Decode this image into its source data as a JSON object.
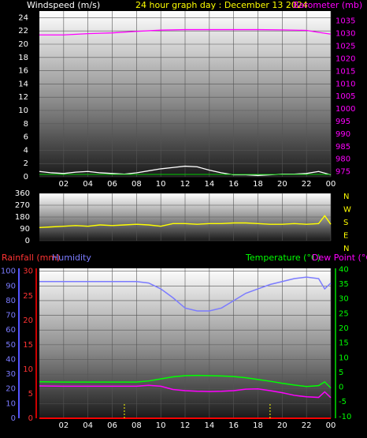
{
  "header": {
    "windspeed_label": "Windspeed (m/s)",
    "graph_title": "24 hour graph day : December 13 2024",
    "barometer_label": "Barometer (mb)"
  },
  "bottom_header": {
    "rainfall_label": "Rainfall (mm)",
    "humidity_label": "Humidity",
    "temperature_label": "Temperature (°C)",
    "dewpoint_label": "Dew Point (°C)"
  },
  "x_ticks": [
    "02",
    "04",
    "06",
    "08",
    "10",
    "12",
    "14",
    "16",
    "18",
    "20",
    "22",
    "00"
  ],
  "colors": {
    "windspeed": "#ffffff",
    "windgust": "#c8c8c8",
    "wind_avg": "#00cc00",
    "barometer": "#ff00ff",
    "direction": "#ffff00",
    "humidity": "#7b7bff",
    "temperature": "#00ff00",
    "dewpoint": "#ff00ff",
    "rainfall": "#ff0000",
    "grid": "#555555",
    "title": "#ffff00"
  },
  "chart_data": [
    {
      "type": "line",
      "name": "wind-barometer",
      "x_unit": "hours since midnight",
      "x_range": [
        0,
        24
      ],
      "left_axis": {
        "label": "Windspeed (m/s)",
        "range": [
          0,
          25
        ],
        "ticks": [
          0,
          2,
          4,
          6,
          8,
          10,
          12,
          14,
          16,
          18,
          20,
          22,
          24
        ]
      },
      "right_axis": {
        "label": "Barometer (mb)",
        "range": [
          973,
          1039
        ],
        "ticks": [
          975,
          980,
          985,
          990,
          995,
          1000,
          1005,
          1010,
          1015,
          1020,
          1025,
          1030,
          1035
        ]
      },
      "series": [
        {
          "name": "Windspeed (m/s)",
          "axis": "left",
          "x": [
            0,
            1,
            2,
            3,
            4,
            5,
            6,
            7,
            8,
            9,
            10,
            11,
            12,
            13,
            14,
            15,
            16,
            17,
            18,
            19,
            20,
            21,
            22,
            23,
            24
          ],
          "y": [
            0.8,
            0.6,
            0.5,
            0.7,
            0.8,
            0.6,
            0.5,
            0.4,
            0.6,
            0.9,
            1.2,
            1.4,
            1.6,
            1.5,
            1.0,
            0.6,
            0.3,
            0.3,
            0.2,
            0.3,
            0.4,
            0.4,
            0.5,
            0.8,
            0.3
          ]
        },
        {
          "name": "Barometer (mb)",
          "axis": "right",
          "x": [
            0,
            2,
            4,
            6,
            8,
            10,
            12,
            14,
            16,
            18,
            20,
            22,
            23,
            24
          ],
          "y": [
            1029.5,
            1029.5,
            1030,
            1030.3,
            1030.9,
            1031.4,
            1031.6,
            1031.6,
            1031.6,
            1031.6,
            1031.5,
            1031.3,
            1030.5,
            1029.8
          ]
        }
      ]
    },
    {
      "type": "line",
      "name": "wind-direction",
      "x_range": [
        0,
        24
      ],
      "left_axis": {
        "range": [
          0,
          360
        ],
        "ticks": [
          0,
          45,
          90,
          135,
          180,
          225,
          270,
          315,
          360
        ]
      },
      "right_axis": {
        "ticks": [
          "N",
          "W",
          "S",
          "E",
          "N"
        ]
      },
      "series": [
        {
          "name": "Wind direction",
          "axis": "left",
          "x": [
            0,
            1,
            2,
            3,
            4,
            5,
            6,
            7,
            8,
            9,
            10,
            11,
            12,
            13,
            14,
            15,
            16,
            17,
            18,
            19,
            20,
            21,
            22,
            23,
            23.5,
            24
          ],
          "y": [
            100,
            105,
            110,
            115,
            110,
            120,
            115,
            120,
            125,
            120,
            110,
            130,
            130,
            125,
            130,
            130,
            135,
            135,
            130,
            125,
            125,
            130,
            125,
            130,
            190,
            125
          ]
        }
      ]
    },
    {
      "type": "line",
      "name": "rain-humidity-temperature",
      "x_range": [
        0,
        24
      ],
      "left_axis": {
        "label": "Rainfall (mm)",
        "range": [
          0,
          30.6
        ],
        "ticks": [
          0,
          5,
          10,
          15,
          20,
          25,
          30
        ]
      },
      "humidity_axis": {
        "label": "Humidity",
        "range": [
          0,
          102
        ],
        "ticks": [
          0,
          10,
          20,
          30,
          40,
          50,
          60,
          70,
          80,
          90,
          100
        ]
      },
      "right_axis": {
        "label": "Temperature (°C)",
        "range": [
          -10.6,
          40.4
        ],
        "ticks": [
          -10,
          -5,
          0,
          5,
          10,
          15,
          20,
          25,
          30,
          35,
          40
        ]
      },
      "series": [
        {
          "name": "Humidity",
          "axis": "humidity",
          "x": [
            0,
            2,
            4,
            6,
            8,
            9,
            10,
            11,
            12,
            13,
            14,
            15,
            16,
            17,
            18,
            19,
            20,
            21,
            22,
            23,
            23.5,
            24
          ],
          "y": [
            93,
            93,
            93,
            93,
            93,
            92,
            88,
            82,
            75,
            73,
            73,
            75,
            80,
            85,
            88,
            91,
            93,
            95,
            96,
            95,
            88,
            92
          ]
        },
        {
          "name": "Temperature (°C)",
          "axis": "right",
          "x": [
            0,
            2,
            4,
            6,
            8,
            9,
            10,
            11,
            12,
            13,
            14,
            15,
            16,
            17,
            18,
            19,
            20,
            21,
            22,
            23,
            23.5,
            24
          ],
          "y": [
            1.8,
            1.7,
            1.7,
            1.7,
            1.7,
            2.1,
            2.8,
            3.5,
            3.9,
            4.0,
            3.9,
            3.8,
            3.6,
            3.2,
            2.6,
            2.0,
            1.3,
            0.7,
            0.2,
            0.5,
            1.8,
            -0.3
          ]
        },
        {
          "name": "Dew Point (°C)",
          "axis": "right",
          "x": [
            0,
            2,
            4,
            6,
            8,
            9,
            10,
            11,
            12,
            13,
            14,
            15,
            16,
            17,
            18,
            19,
            20,
            21,
            22,
            23,
            23.5,
            24
          ],
          "y": [
            0.4,
            0.3,
            0.3,
            0.3,
            0.3,
            0.6,
            0.3,
            -0.8,
            -1.2,
            -1.4,
            -1.5,
            -1.4,
            -1.2,
            -0.7,
            -0.6,
            -1.2,
            -1.9,
            -2.8,
            -3.3,
            -3.5,
            -1.6,
            -3.6
          ]
        },
        {
          "name": "Rainfall (mm)",
          "axis": "left",
          "x": [
            0,
            24
          ],
          "y": [
            0,
            0
          ]
        }
      ]
    }
  ]
}
